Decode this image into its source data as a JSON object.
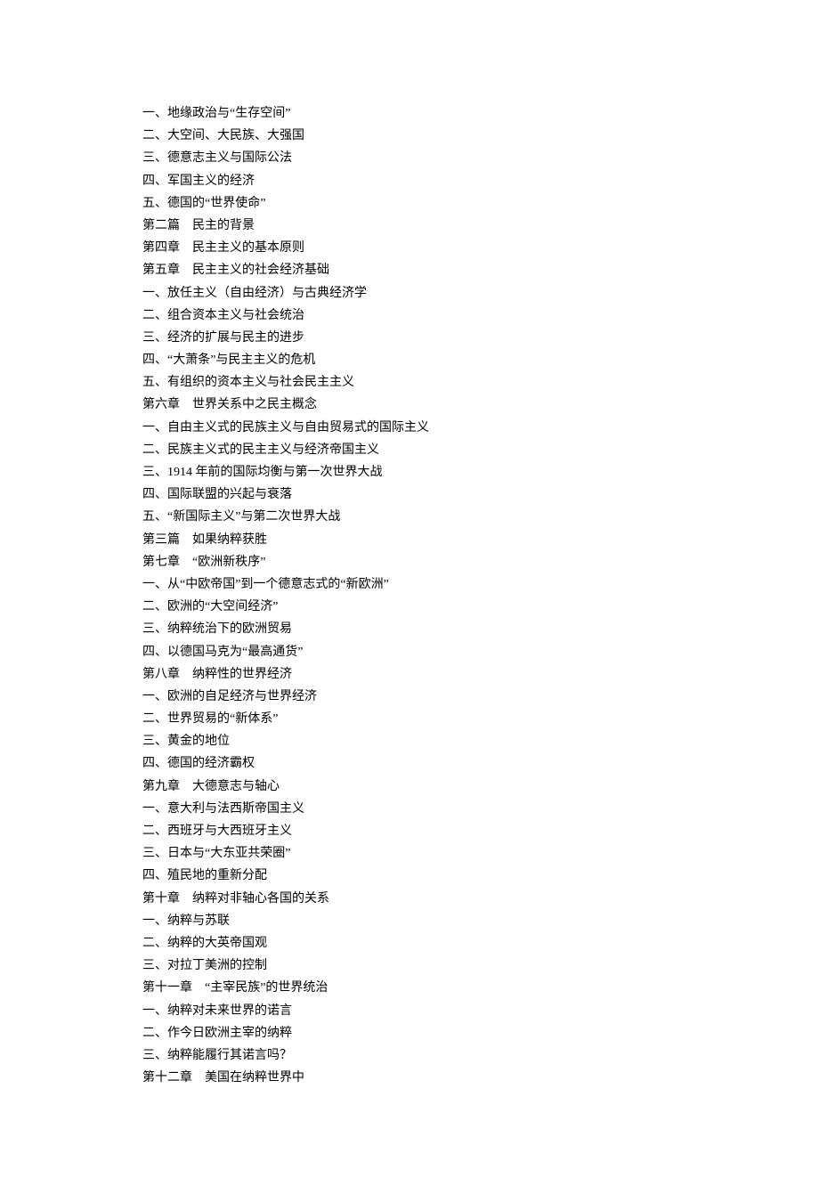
{
  "toc": [
    "一、地缘政治与“生存空间”",
    "二、大空间、大民族、大强国",
    "三、德意志主义与国际公法",
    "四、军国主义的经济",
    "五、德国的“世界使命”",
    "第二篇　民主的背景",
    "第四章　民主主义的基本原则",
    "第五章　民主主义的社会经济基础",
    "一、放任主义（自由经济）与古典经济学",
    "二、组合资本主义与社会统治",
    "三、经济的扩展与民主的进步",
    "四、“大萧条”与民主主义的危机",
    "五、有组织的资本主义与社会民主主义",
    "第六章　世界关系中之民主概念",
    "一、自由主义式的民族主义与自由贸易式的国际主义",
    "二、民族主义式的民主主义与经济帝国主义",
    "三、1914 年前的国际均衡与第一次世界大战",
    "四、国际联盟的兴起与衰落",
    "五、“新国际主义”与第二次世界大战",
    "第三篇　如果纳粹获胜",
    "第七章　“欧洲新秩序”",
    "一、从“中欧帝国”到一个德意志式的“新欧洲”",
    "二、欧洲的“大空间经济”",
    "三、纳粹统治下的欧洲贸易",
    "四、以德国马克为“最高通货”",
    "第八章　纳粹性的世界经济",
    "一、欧洲的自足经济与世界经济",
    "二、世界贸易的“新体系”",
    "三、黄金的地位",
    "四、德国的经济霸权",
    "第九章　大德意志与轴心",
    "一、意大利与法西斯帝国主义",
    "二、西班牙与大西班牙主义",
    "三、日本与“大东亚共荣圈”",
    "四、殖民地的重新分配",
    "第十章　纳粹对非轴心各国的关系",
    "一、纳粹与苏联",
    "二、纳粹的大英帝国观",
    "三、对拉丁美洲的控制",
    "第十一章　“主宰民族”的世界统治",
    "一、纳粹对未来世界的诺言",
    "二、作今日欧洲主宰的纳粹",
    "三、纳粹能履行其诺言吗？",
    "第十二章　美国在纳粹世界中"
  ]
}
